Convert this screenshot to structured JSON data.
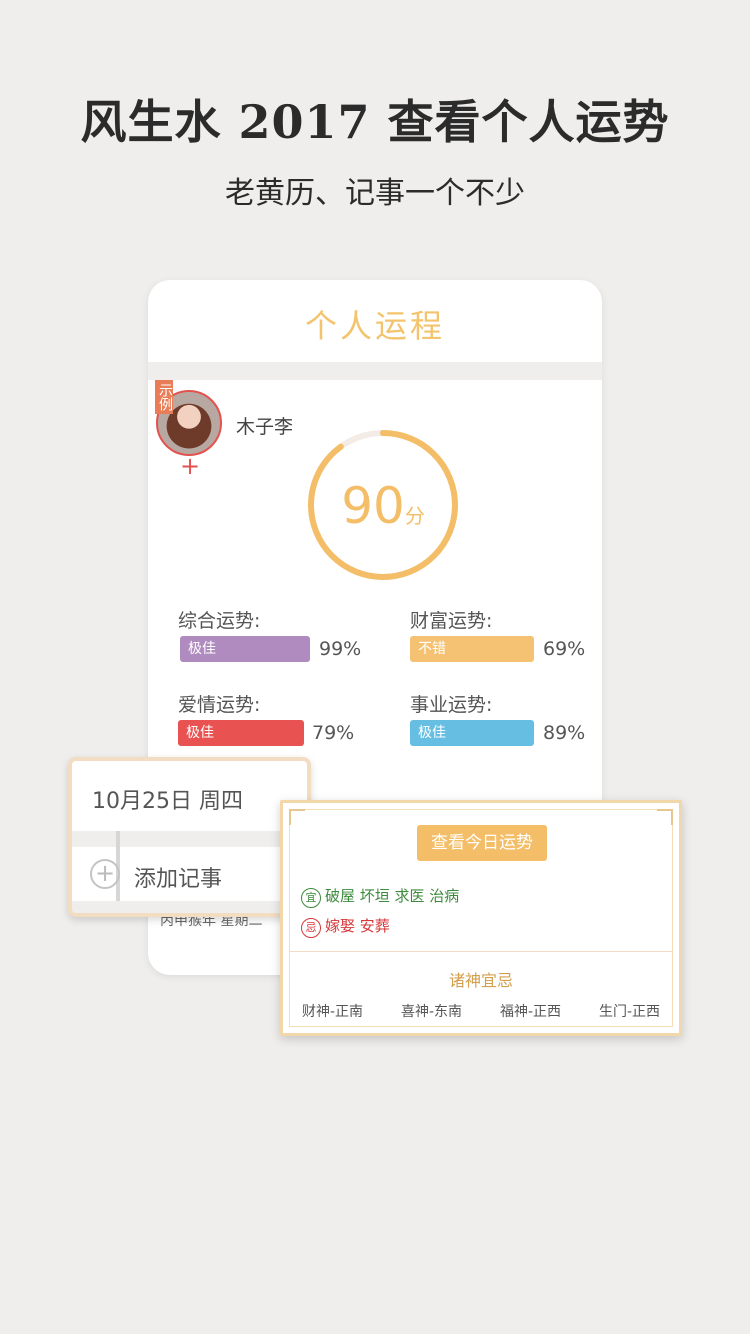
{
  "headline": "风生水 2017 查看个人运势",
  "subline": "老黄历、记事一个不少",
  "phone": {
    "title": "个人运程",
    "sample_tag": "示例",
    "user_name": "木子李",
    "score": {
      "value": "90",
      "unit": "分",
      "fraction": 0.9
    },
    "fortunes": [
      {
        "label": "综合运势:",
        "badge": "极佳",
        "percent": "99%",
        "color": "#b08bc0"
      },
      {
        "label": "财富运势:",
        "badge": "不错",
        "percent": "69%",
        "color": "#f4c272"
      },
      {
        "label": "爱情运势:",
        "badge": "极佳",
        "percent": "79%",
        "color": "#e85352"
      },
      {
        "label": "事业运势:",
        "badge": "极佳",
        "percent": "89%",
        "color": "#66bfe3"
      }
    ],
    "under_text": "丙申猴年 星期二"
  },
  "date_card": {
    "date": "10月25日  周四",
    "add_note": "添加记事"
  },
  "almanac": {
    "view_button": "查看今日运势",
    "good_badge": "宜",
    "good_items": "破屋 坏垣 求医 治病",
    "bad_badge": "忌",
    "bad_items": "嫁娶 安葬",
    "gods_title": "诸神宜忌",
    "directions": [
      "财神-正南",
      "喜神-东南",
      "福神-正西",
      "生门-正西"
    ]
  },
  "colors": {
    "accent": "#f4be68",
    "background": "#efeeec"
  }
}
